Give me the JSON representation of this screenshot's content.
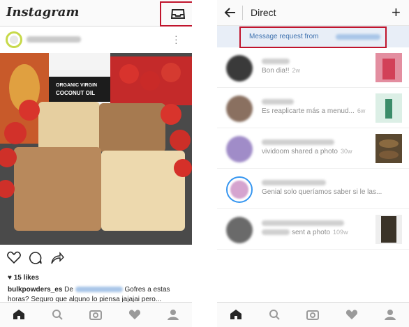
{
  "left": {
    "logo": "Instagram",
    "post": {
      "likes_label": "15 likes",
      "caption_user": "bulkpowders_es",
      "caption_pre": " De ",
      "caption_post": " Gofres a estas horas? Seguro que alguno lo piensa jajajai pero..."
    },
    "bottom_nav": [
      "home-icon",
      "search-icon",
      "camera-icon",
      "heart-icon",
      "profile-icon"
    ]
  },
  "right": {
    "title": "Direct",
    "request_text": "Message request from",
    "threads": [
      {
        "message": "Bon dia!!",
        "time": "2w"
      },
      {
        "message": "Es reaplicarte más a menud...",
        "time": "6w"
      },
      {
        "message": "vividoom shared a photo",
        "time": "30w"
      },
      {
        "message": "Genial solo queríamos saber si le las...",
        "time": ""
      },
      {
        "message": "sent a photo",
        "time": "109w"
      }
    ]
  },
  "colors": {
    "highlight_box": "#c0142c",
    "link_blue": "#3f72af",
    "request_bg": "#e8eef7"
  }
}
